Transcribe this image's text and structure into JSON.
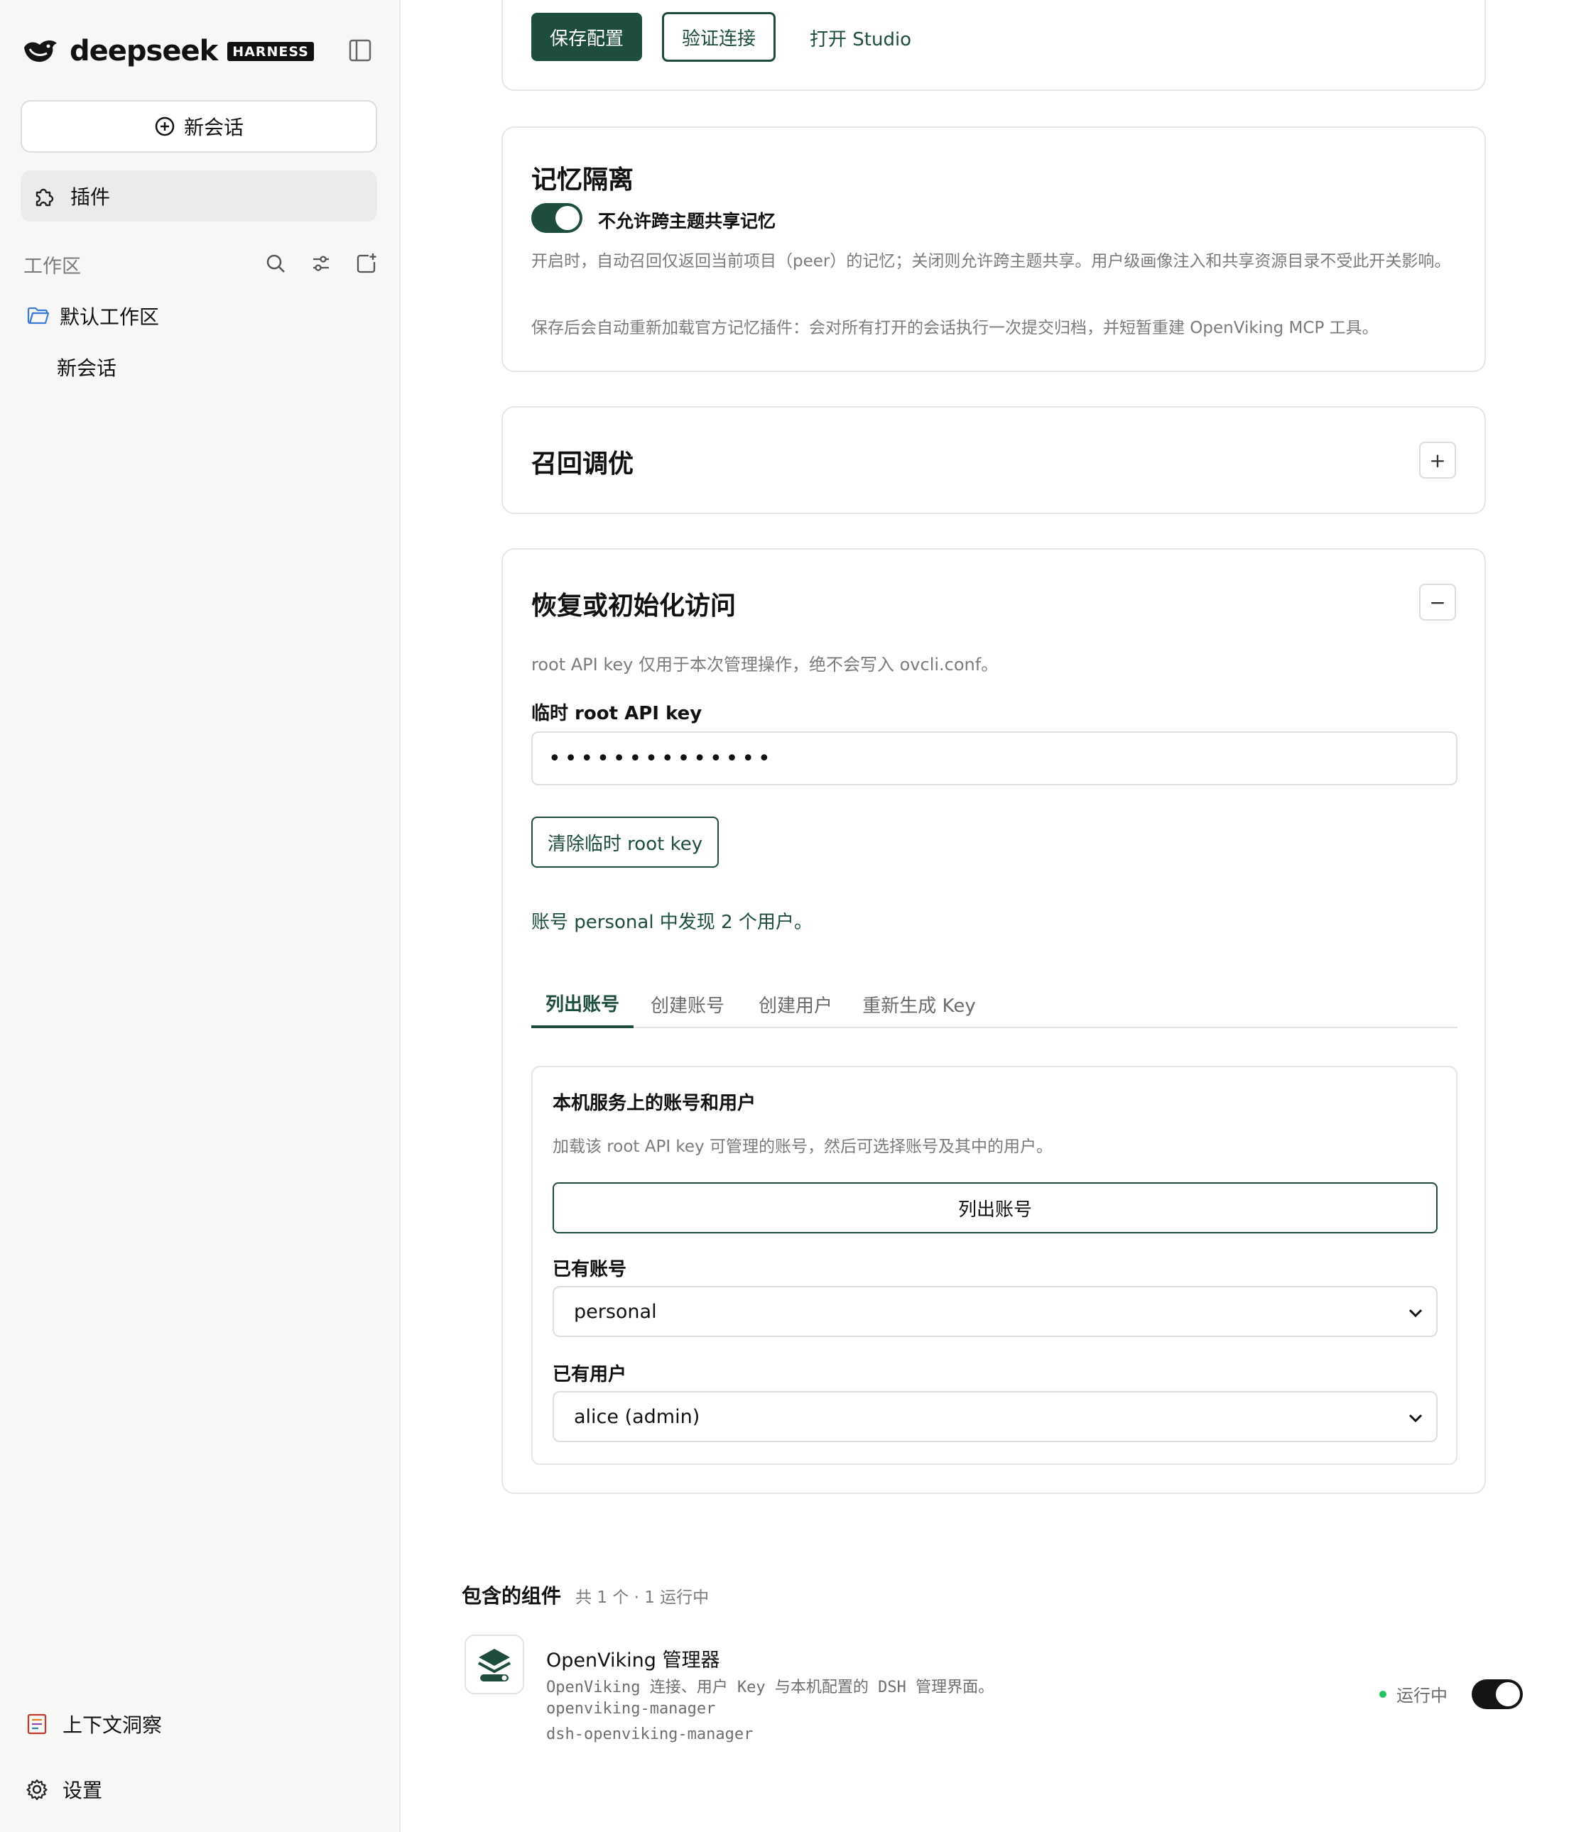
{
  "sidebar": {
    "brand_name": "deepseek",
    "brand_badge": "HARNESS",
    "new_chat_label": "新会话",
    "plugins_label": "插件",
    "workspace_title": "工作区",
    "default_workspace": "默认工作区",
    "session_label": "新会话",
    "context_insight_label": "上下文洞察",
    "settings_label": "设置"
  },
  "top_actions": {
    "save_label": "保存配置",
    "verify_label": "验证连接",
    "studio_label": "打开 Studio"
  },
  "memory_isolation": {
    "title": "记忆隔离",
    "toggle_label": "不允许跨主题共享记忆",
    "toggle_on": true,
    "desc_1": "开启时，自动召回仅返回当前项目（peer）的记忆；关闭则允许跨主题共享。用户级画像注入和共享资源目录不受此开关影响。",
    "desc_2": "保存后会自动重新加载官方记忆插件：会对所有打开的会话执行一次提交归档，并短暂重建 OpenViking MCP 工具。"
  },
  "recall_tuning": {
    "title": "召回调优",
    "expand_symbol": "+"
  },
  "restore_access": {
    "title": "恢复或初始化访问",
    "collapse_symbol": "−",
    "note": "root API key 仅用于本次管理操作，绝不会写入 ovcli.conf。",
    "key_label": "临时 root API key",
    "key_value": "••••••••••••••",
    "clear_label": "清除临时 root key",
    "found_text": "账号 personal 中发现 2 个用户。",
    "tabs": [
      "列出账号",
      "创建账号",
      "创建用户",
      "重新生成 Key"
    ],
    "active_tab": "列出账号",
    "panel": {
      "title": "本机服务上的账号和用户",
      "desc": "加载该 root API key 可管理的账号，然后可选择账号及其中的用户。",
      "list_button": "列出账号",
      "account_label": "已有账号",
      "account_value": "personal",
      "user_label": "已有用户",
      "user_value": "alice (admin)"
    }
  },
  "components": {
    "title": "包含的组件",
    "count": "共 1 个 · 1 运行中",
    "items": [
      {
        "name": "OpenViking 管理器",
        "desc": "OpenViking 连接、用户 Key 与本机配置的 DSH 管理界面。",
        "id": "openviking-manager",
        "package": "dsh-openviking-manager",
        "status": "运行中",
        "enabled": true
      }
    ]
  },
  "colors": {
    "accent": "#1e4d3c",
    "sidebar_bg": "#f7f7f6",
    "status_green": "#22c55e"
  }
}
